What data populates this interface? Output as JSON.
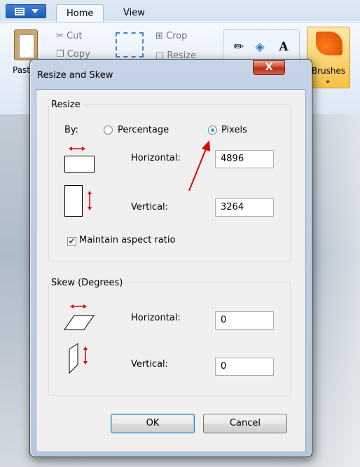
{
  "app": {
    "tabs": [
      {
        "label": "Home"
      },
      {
        "label": "View"
      }
    ],
    "ribbon": {
      "paste_label": "Past",
      "cut_label": "Cut",
      "copy_label": "Copy",
      "crop_label": "Crop",
      "resize_label": "Resize",
      "brushes_label": "Brushes"
    }
  },
  "dialog": {
    "title": "Resize and Skew",
    "close_label": "X",
    "resize": {
      "legend": "Resize",
      "by_label": "By:",
      "percentage_label": "Percentage",
      "pixels_label": "Pixels",
      "selected": "Pixels",
      "horizontal_label": "Horizontal:",
      "horizontal_value": "4896",
      "vertical_label": "Vertical:",
      "vertical_value": "3264",
      "maintain_label": "Maintain aspect ratio",
      "maintain_checked": true
    },
    "skew": {
      "legend": "Skew (Degrees)",
      "horizontal_label": "Horizontal:",
      "horizontal_value": "0",
      "vertical_label": "Vertical:",
      "vertical_value": "0"
    },
    "ok_label": "OK",
    "cancel_label": "Cancel"
  },
  "colors": {
    "arrow": "#e00000",
    "icon_red": "#e00000",
    "ribbon_blue": "#dce7f5"
  }
}
